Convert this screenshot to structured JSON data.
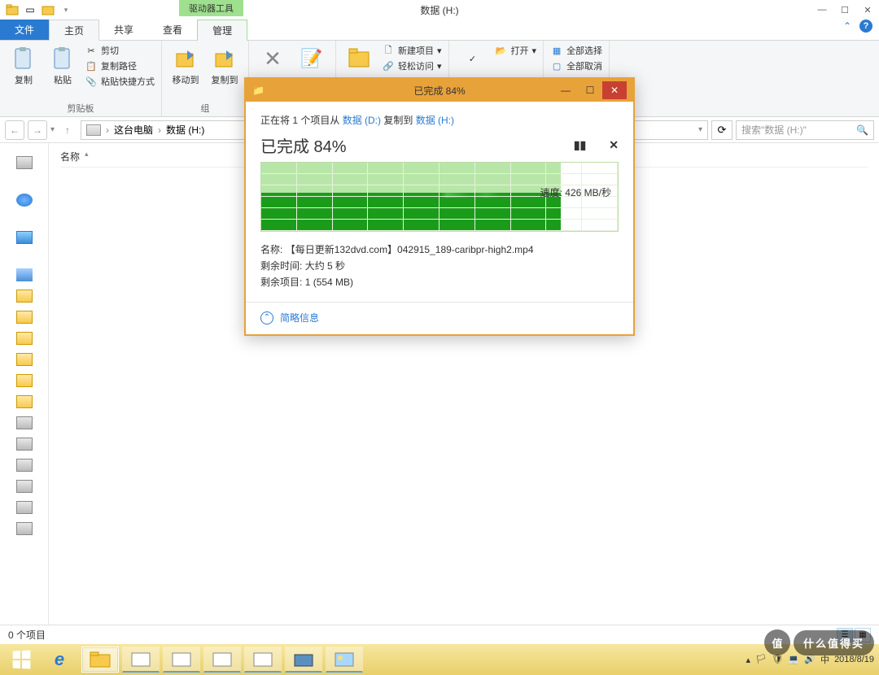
{
  "titlebar": {
    "context_tab": "驱动器工具",
    "window_title": "数据 (H:)"
  },
  "tabs": {
    "file": "文件",
    "home": "主页",
    "share": "共享",
    "view": "查看",
    "manage": "管理"
  },
  "ribbon": {
    "clipboard": {
      "group": "剪贴板",
      "copy": "复制",
      "paste": "粘贴",
      "cut": "剪切",
      "copy_path": "复制路径",
      "paste_shortcut": "粘贴快捷方式"
    },
    "organize": {
      "move_to": "移动到",
      "copy_to": "复制到"
    },
    "new": {
      "new_item": "新建项目",
      "easy_access": "轻松访问"
    },
    "open": {
      "open": "打开"
    },
    "select": {
      "select_all": "全部选择",
      "select_none": "全部取消"
    }
  },
  "nav": {
    "this_pc": "这台电脑",
    "location": "数据 (H:)",
    "search_placeholder": "搜索\"数据 (H:)\""
  },
  "listview": {
    "col_name": "名称"
  },
  "statusbar": {
    "items": "0 个项目"
  },
  "dialog": {
    "title": "已完成 84%",
    "copying_prefix": "正在将 1 个项目从 ",
    "src": "数据 (D:)",
    "copying_mid": " 复制到 ",
    "dst": "数据 (H:)",
    "percent": "已完成 84%",
    "speed": "速度: 426 MB/秒",
    "name_label": "名称:",
    "name_value": "【每日更新132dvd.com】042915_189-caribpr-high2.mp4",
    "time_label": "剩余时间:",
    "time_value": "大约 5 秒",
    "items_label": "剩余项目:",
    "items_value": "1 (554 MB)",
    "more": "简略信息"
  },
  "taskbar": {
    "date": "2018/8/19"
  },
  "watermark": "什么值得买"
}
